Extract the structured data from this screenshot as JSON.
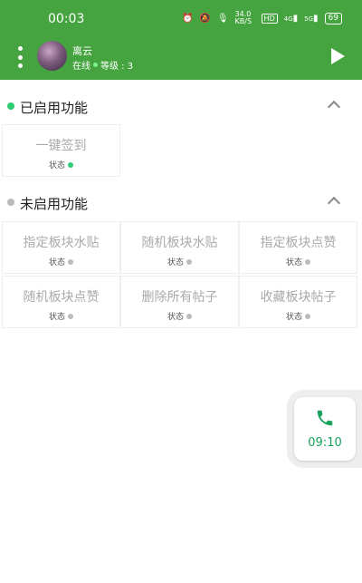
{
  "status_bar": {
    "time": "00:03",
    "net_speed": "34.0 KB/S",
    "hd": "HD",
    "signal1": "4G",
    "signal2": "5G",
    "battery": "69"
  },
  "header": {
    "user_name": "离云",
    "online": "在线",
    "level": "等级 : 3"
  },
  "enabled_section": {
    "title": "已启用功能",
    "bullet_color": "#2ecc71",
    "items": [
      {
        "label": "一键签到",
        "state": "状态"
      }
    ]
  },
  "disabled_section": {
    "title": "未启用功能",
    "bullet_color": "#bbbbbb",
    "items": [
      {
        "label": "指定板块水贴",
        "state": "状态"
      },
      {
        "label": "随机板块水贴",
        "state": "状态"
      },
      {
        "label": "指定板块点赞",
        "state": "状态"
      },
      {
        "label": "随机板块点赞",
        "state": "状态"
      },
      {
        "label": "删除所有帖子",
        "state": "状态"
      },
      {
        "label": "收藏板块帖子",
        "state": "状态"
      }
    ]
  },
  "call_widget": {
    "duration": "09:10"
  },
  "colors": {
    "header_bg": "#45a43f",
    "enabled_dot": "#2ecc71",
    "disabled_dot": "#bbbbbb",
    "call_green": "#1aa15c"
  }
}
